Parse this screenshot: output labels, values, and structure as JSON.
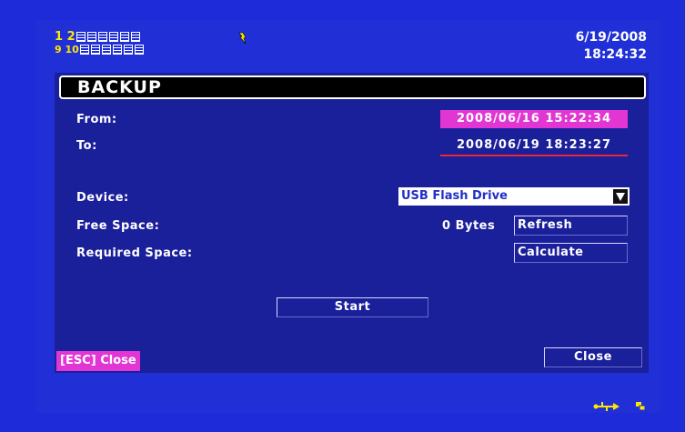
{
  "status": {
    "row1_numbers": "1 2",
    "row2_numbers": "9 10",
    "date": "6/19/2008",
    "time": "18:24:32",
    "icons": [
      "camera-channel-icon",
      "alarm-icon",
      "usb-icon",
      "network-icon"
    ]
  },
  "dialog": {
    "title": "BACKUP",
    "from_label": "From:",
    "from_value": "2008/06/16  15:22:34",
    "to_label": "To:",
    "to_value": "2008/06/19  18:23:27",
    "device_label": "Device:",
    "device_value": "USB Flash Drive",
    "free_space_label": "Free Space:",
    "free_space_value": "0 Bytes",
    "refresh_label": "Refresh",
    "required_space_label": "Required Space:",
    "calculate_label": "Calculate",
    "start_label": "Start",
    "esc_hint": "[ESC] Close",
    "close_label": "Close"
  },
  "colors": {
    "background": "#1d2bd8",
    "dialog": "#1a1f9a",
    "highlight": "#e236d4",
    "channel_numbers": "#ffe600",
    "underline": "#e8283a"
  }
}
